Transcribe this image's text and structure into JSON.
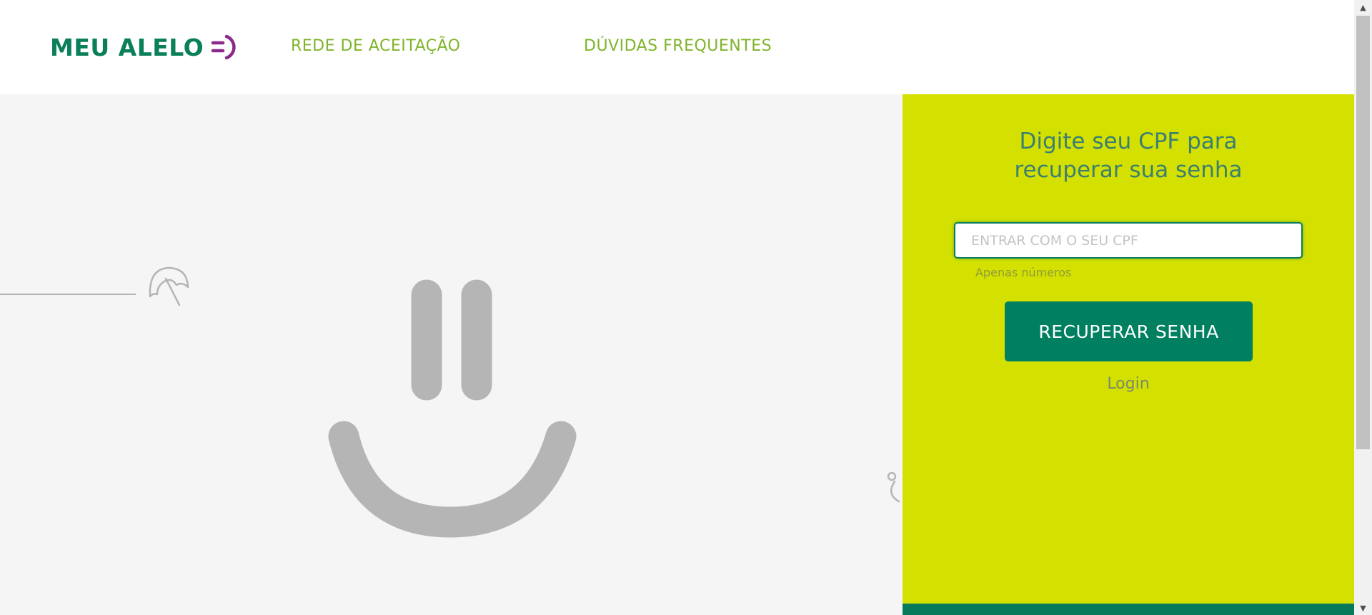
{
  "header": {
    "logo_text": "MEU ALELO",
    "nav": [
      {
        "label": "REDE DE ACEITAÇÃO"
      },
      {
        "label": "DÚVIDAS FREQUENTES"
      }
    ]
  },
  "recovery": {
    "title_line1": "Digite seu CPF para",
    "title_line2": "recuperar sua senha",
    "cpf_placeholder": "ENTRAR COM O SEU CPF",
    "cpf_value": "",
    "hint": "Apenas números",
    "submit_label": "RECUPERAR SENHA",
    "login_link": "Login"
  },
  "illustration": {
    "icons": [
      "smiley-icon",
      "beach-umbrella-icon",
      "cocktail-icon"
    ]
  },
  "colors": {
    "brand_green": "#0a7f5a",
    "nav_green": "#7fb42a",
    "panel_lime": "#d4e100",
    "button_green": "#008060",
    "smiley_gray": "#b5b5b6",
    "logo_purple": "#8a2a8a"
  }
}
